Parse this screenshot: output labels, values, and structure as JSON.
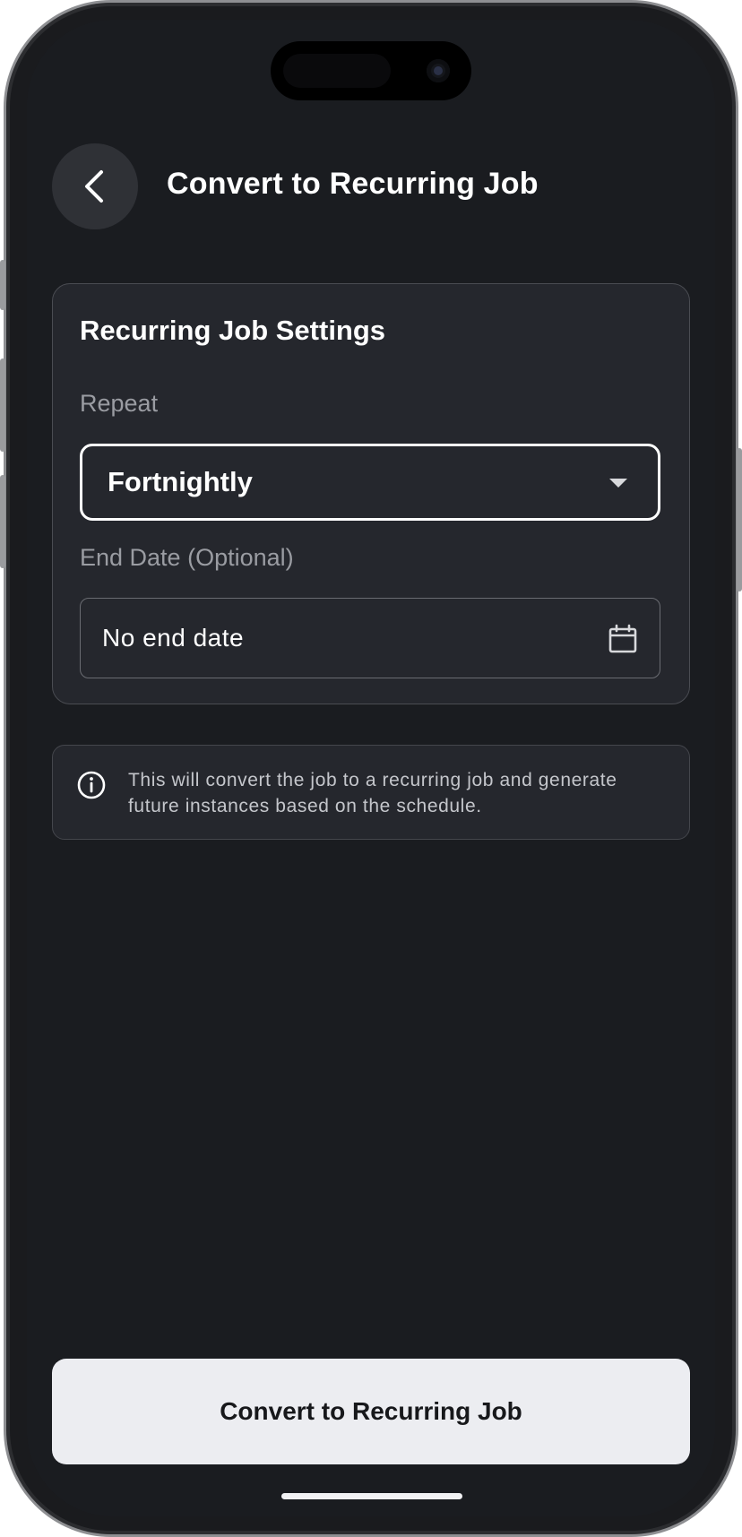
{
  "header": {
    "title": "Convert to Recurring Job",
    "back_icon": "chevron-left-icon"
  },
  "settings": {
    "title": "Recurring Job Settings",
    "repeat_label": "Repeat",
    "repeat_value": "Fortnightly",
    "end_date_label": "End Date (Optional)",
    "end_date_value": "No end date",
    "calendar_icon": "calendar-icon"
  },
  "info": {
    "icon": "info-icon",
    "text": "This will convert the job to a recurring job and generate future instances based on the schedule."
  },
  "actions": {
    "convert_label": "Convert to Recurring Job"
  },
  "colors": {
    "background": "#1a1c20",
    "card": "#25272d",
    "primary_button": "#ecedf1",
    "text_primary": "#ffffff",
    "text_muted": "#9a9ca2"
  }
}
